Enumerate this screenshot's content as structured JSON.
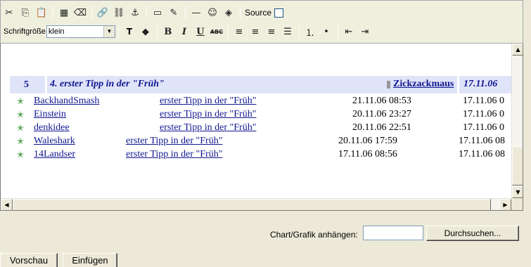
{
  "toolbar": {
    "row1_icons": [
      "cut-icon",
      "copy-icon",
      "paste-icon",
      "table-icon",
      "eraser-icon",
      "link-icon",
      "unlink-icon",
      "anchor-icon",
      "template-icon",
      "edit-icon",
      "horizontal-rule-icon",
      "smiley-icon",
      "special-char-icon"
    ],
    "source_label": "Source",
    "font_size_label": "Schriftgröße",
    "font_size_value": "klein",
    "bold_label": "B",
    "italic_label": "I",
    "underline_label": "U",
    "strike_label": "ABC"
  },
  "thread": {
    "number": "5",
    "title": "4. erster Tipp in der \"Früh\"",
    "user": "Zickzackmaus",
    "date": "17.11.06"
  },
  "replies": [
    {
      "author": "BackhandSmash",
      "subject": "erster Tipp in der \"Früh\"",
      "date": "21.11.06 08:53",
      "date2": "17.11.06 0"
    },
    {
      "author": "Einstein",
      "subject": "erster Tipp in der \"Früh\"",
      "date": "20.11.06 23:27",
      "date2": "17.11.06 0"
    },
    {
      "author": "denkidee",
      "subject": "erster Tipp in der \"Früh\"",
      "date": "20.11.06 22:51",
      "date2": "17.11.06 0"
    },
    {
      "author": "Waleshark",
      "subject": "erster Tipp in der \"Früh\"",
      "date": "20.11.06 17:59",
      "date2": "17.11.06 08"
    },
    {
      "author": "14Landser",
      "subject": "erster Tipp in der \"Früh\"",
      "date": "17.11.06 08:56",
      "date2": "17.11.06 08"
    }
  ],
  "attachment": {
    "label": "Chart/Grafik anhängen:",
    "input_value": "",
    "browse_label": "Durchsuchen..."
  },
  "buttons": {
    "preview": "Vorschau",
    "insert": "Einfügen"
  }
}
